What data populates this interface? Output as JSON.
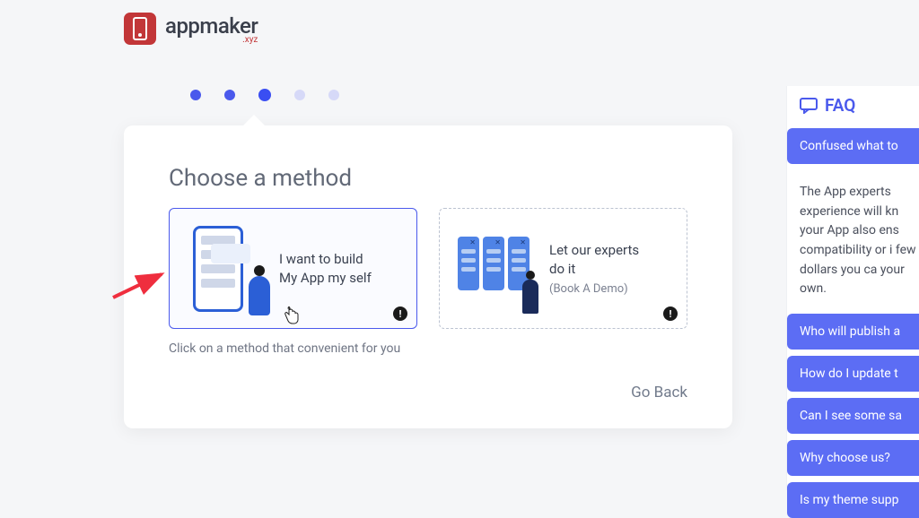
{
  "logo": {
    "text": "appmaker",
    "sub": ".xyz"
  },
  "stepper": {
    "current": 3,
    "total": 5
  },
  "card": {
    "title": "Choose a method",
    "helper": "Click on a method that convenient for you",
    "go_back": "Go Back"
  },
  "methods": [
    {
      "line1": "I want to build",
      "line2": "My App my self",
      "sub": "",
      "selected": true
    },
    {
      "line1": "Let our experts",
      "line2": "do it",
      "sub": "(Book A Demo)",
      "selected": false
    }
  ],
  "faq": {
    "title": "FAQ",
    "items": [
      "Confused what to",
      "Who will publish a",
      "How do I update t",
      "Can I see some sa",
      "Why choose us?",
      "Is my theme supp"
    ],
    "expanded_index": 0,
    "expanded_text": "The App experts experience will kn your App also ens compatibility or i few dollars you ca your own."
  }
}
